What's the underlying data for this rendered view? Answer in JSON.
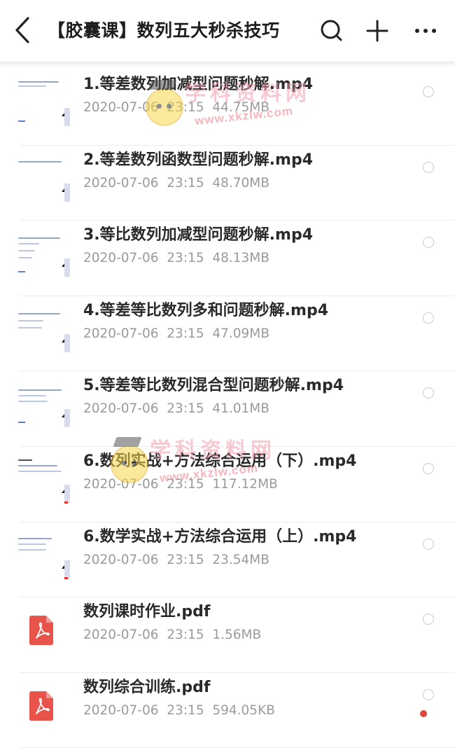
{
  "header": {
    "title": "【胶囊课】数列五大秒杀技巧"
  },
  "files": [
    {
      "name": "1.等差数列加减型问题秒解.mp4",
      "meta": "2020-07-06  23:15  44.75MB",
      "type": "video"
    },
    {
      "name": "2.等差数列函数型问题秒解.mp4",
      "meta": "2020-07-06  23:15  48.70MB",
      "type": "video"
    },
    {
      "name": "3.等比数列加减型问题秒解.mp4",
      "meta": "2020-07-06  23:15  48.13MB",
      "type": "video"
    },
    {
      "name": "4.等差等比数列多和问题秒解.mp4",
      "meta": "2020-07-06  23:15  47.09MB",
      "type": "video"
    },
    {
      "name": "5.等差等比数列混合型问题秒解.mp4",
      "meta": "2020-07-06  23:15  41.01MB",
      "type": "video"
    },
    {
      "name": "6.数列实战+方法综合运用（下）.mp4",
      "meta": "2020-07-06  23:15  117.12MB",
      "type": "video"
    },
    {
      "name": "6.数学实战+方法综合运用（上）.mp4",
      "meta": "2020-07-06  23:15  23.54MB",
      "type": "video"
    },
    {
      "name": "数列课时作业.pdf",
      "meta": "2020-07-06  23:15  1.56MB",
      "type": "pdf"
    },
    {
      "name": "数列综合训练.pdf",
      "meta": "2020-07-06  23:15  594.05KB",
      "type": "pdf"
    }
  ],
  "watermark": {
    "cn": "学科资料网",
    "url": "www.xkzlw.com"
  },
  "colors": {
    "pdf_red": "#e8534b",
    "meta_gray": "#9a9a9a",
    "radio_border": "#c8c8c8"
  }
}
